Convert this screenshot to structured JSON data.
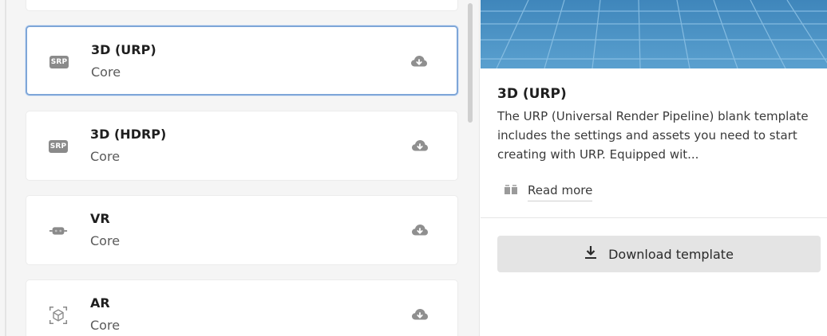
{
  "templates": [
    {
      "title": "3D (URP)",
      "category": "Core",
      "icon": "srp-icon",
      "icon_text": "SRP",
      "action_icon": "cloud-download-icon",
      "selected": true
    },
    {
      "title": "3D (HDRP)",
      "category": "Core",
      "icon": "srp-icon",
      "icon_text": "SRP",
      "action_icon": "cloud-download-icon",
      "selected": false
    },
    {
      "title": "VR",
      "category": "Core",
      "icon": "vr-headset-icon",
      "action_icon": "cloud-download-icon",
      "selected": false
    },
    {
      "title": "AR",
      "category": "Core",
      "icon": "ar-cube-icon",
      "action_icon": "cloud-download-icon",
      "selected": false
    }
  ],
  "details": {
    "title": "3D (URP)",
    "description": "The URP (Universal Render Pipeline) blank template includes the settings and assets you need to start creating with URP. Equipped wit...",
    "read_more_label": "Read more",
    "read_more_icon": "book-icon",
    "download_label": "Download template",
    "download_icon": "download-icon"
  },
  "colors": {
    "selected_border": "#7ea6d8",
    "preview_sky": "#4a8fc0",
    "button_bg": "#e4e4e4"
  }
}
